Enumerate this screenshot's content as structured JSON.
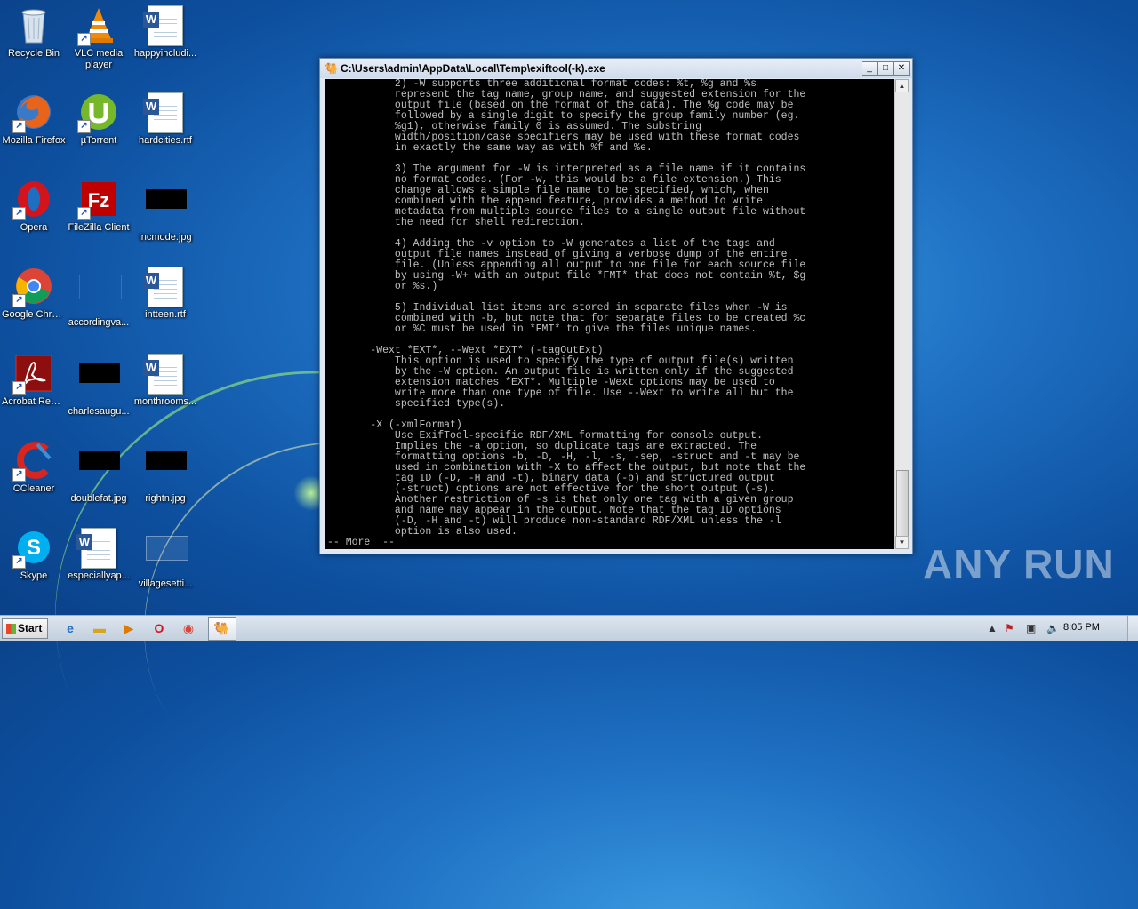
{
  "desktop": {
    "icons": [
      {
        "label": "Recycle Bin"
      },
      {
        "label": "VLC media player"
      },
      {
        "label": "happyincludi..."
      },
      {
        "label": "Mozilla Firefox"
      },
      {
        "label": "µTorrent"
      },
      {
        "label": "hardcities.rtf"
      },
      {
        "label": "Opera"
      },
      {
        "label": "FileZilla Client"
      },
      {
        "label": "incmode.jpg"
      },
      {
        "label": "Google Chrome"
      },
      {
        "label": "accordingva..."
      },
      {
        "label": "intteen.rtf"
      },
      {
        "label": "Acrobat Reader DC"
      },
      {
        "label": "charlesaugu..."
      },
      {
        "label": "monthrooms..."
      },
      {
        "label": "CCleaner"
      },
      {
        "label": "doublefat.jpg"
      },
      {
        "label": "rightn.jpg"
      },
      {
        "label": "Skype"
      },
      {
        "label": "especiallyap..."
      },
      {
        "label": "villagesetti..."
      }
    ]
  },
  "window": {
    "title": "C:\\Users\\admin\\AppData\\Local\\Temp\\exiftool(-k).exe",
    "minimize": "_",
    "maximize": "□",
    "close": "✕",
    "console_text": "           2) -W supports three additional format codes: %t, %g and %s\n           represent the tag name, group name, and suggested extension for the\n           output file (based on the format of the data). The %g code may be\n           followed by a single digit to specify the group family number (eg.\n           %g1), otherwise family 0 is assumed. The substring\n           width/position/case specifiers may be used with these format codes\n           in exactly the same way as with %f and %e.\n\n           3) The argument for -W is interpreted as a file name if it contains\n           no format codes. (For -w, this would be a file extension.) This\n           change allows a simple file name to be specified, which, when\n           combined with the append feature, provides a method to write\n           metadata from multiple source files to a single output file without\n           the need for shell redirection.\n\n           4) Adding the -v option to -W generates a list of the tags and\n           output file names instead of giving a verbose dump of the entire\n           file. (Unless appending all output to one file for each source file\n           by using -W+ with an output file *FMT* that does not contain %t, $g\n           or %s.)\n\n           5) Individual list items are stored in separate files when -W is\n           combined with -b, but note that for separate files to be created %c\n           or %C must be used in *FMT* to give the files unique names.\n\n       -Wext *EXT*, --Wext *EXT* (-tagOutExt)\n           This option is used to specify the type of output file(s) written\n           by the -W option. An output file is written only if the suggested\n           extension matches *EXT*. Multiple -Wext options may be used to\n           write more than one type of file. Use --Wext to write all but the\n           specified type(s).\n\n       -X (-xmlFormat)\n           Use ExifTool-specific RDF/XML formatting for console output.\n           Implies the -a option, so duplicate tags are extracted. The\n           formatting options -b, -D, -H, -l, -s, -sep, -struct and -t may be\n           used in combination with -X to affect the output, but note that the\n           tag ID (-D, -H and -t), binary data (-b) and structured output\n           (-struct) options are not effective for the short output (-s).\n           Another restriction of -s is that only one tag with a given group\n           and name may appear in the output. Note that the tag ID options\n           (-D, -H and -t) will produce non-standard RDF/XML unless the -l\n           option is also used.\n-- More  --"
  },
  "watermark": "ANY RUN",
  "taskbar": {
    "start_label": "Start",
    "clock": "8:05 PM"
  }
}
